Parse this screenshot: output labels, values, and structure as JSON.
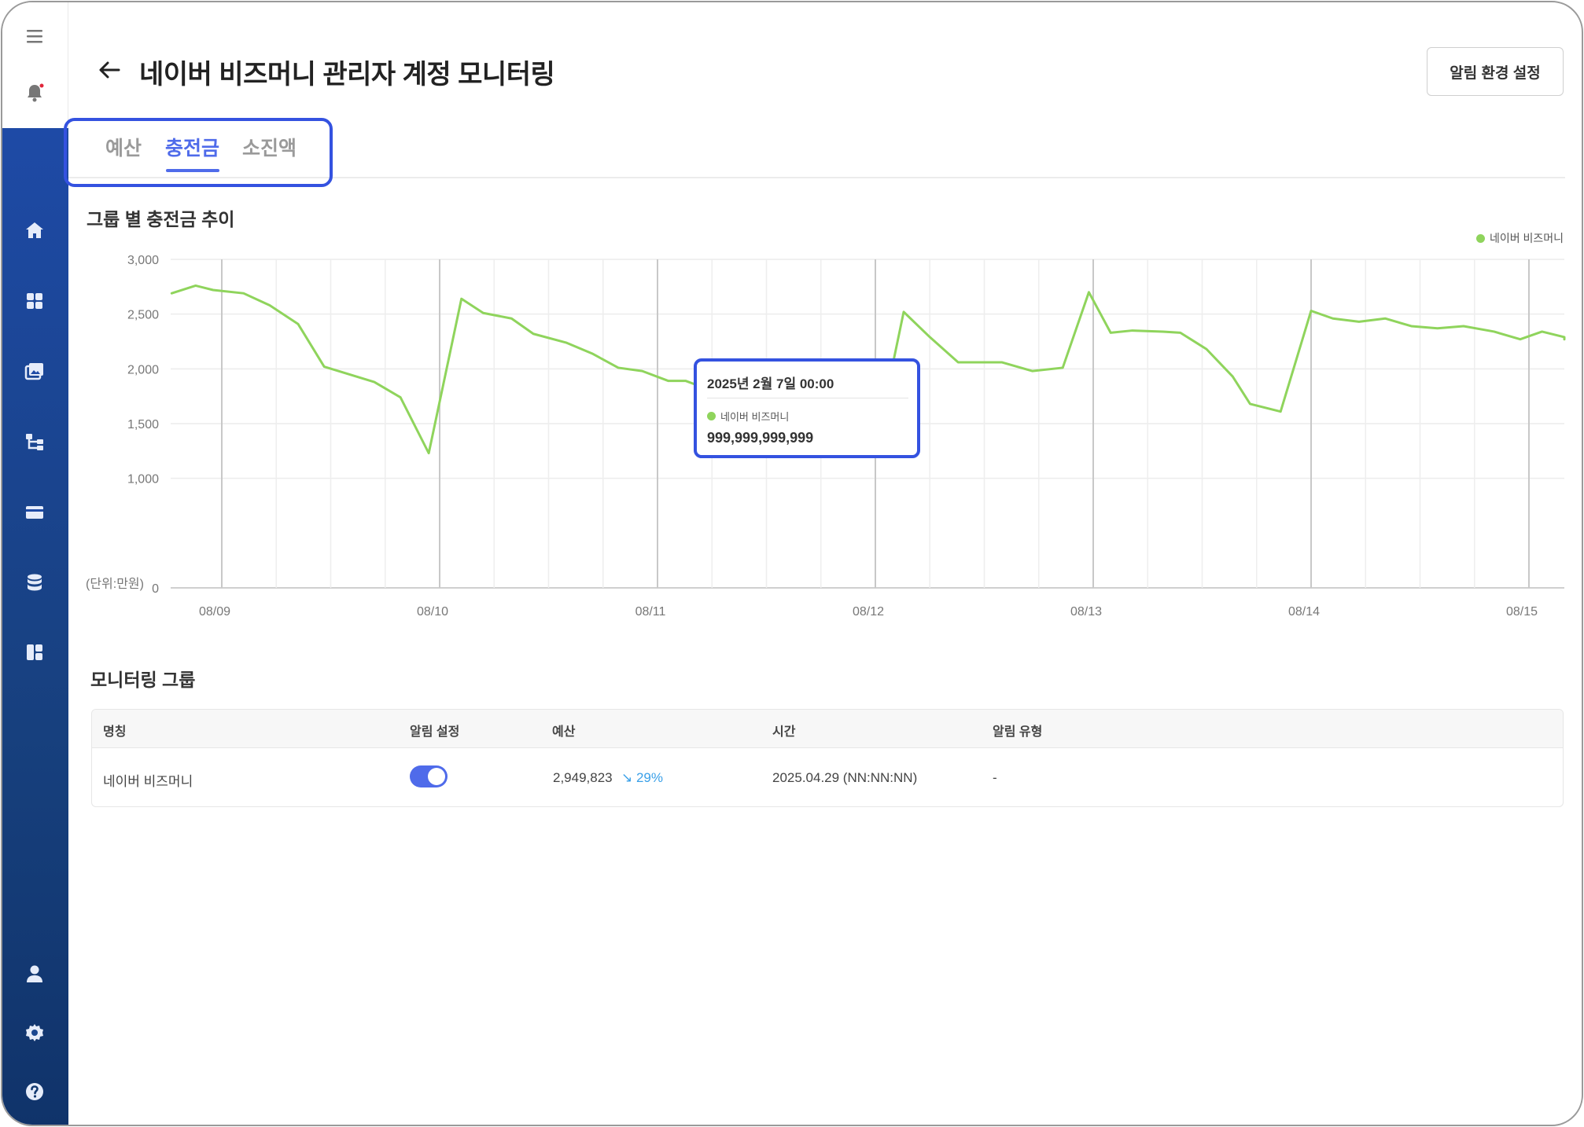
{
  "header": {
    "title": "네이버 비즈머니 관리자 계정 모니터링",
    "settings_label": "알림 환경 설정"
  },
  "sidebar": {
    "top_icons": [
      "menu-icon",
      "bell-icon"
    ],
    "items": [
      "home-icon",
      "dashboard-icon",
      "media-icon",
      "hierarchy-icon",
      "card-icon",
      "database-icon",
      "layout-icon"
    ],
    "bottom_items": [
      "user-icon",
      "gear-icon",
      "help-icon"
    ]
  },
  "tabs": [
    {
      "label": "예산",
      "active": false
    },
    {
      "label": "충전금",
      "active": true
    },
    {
      "label": "소진액",
      "active": false
    }
  ],
  "chart": {
    "title": "그룹 별 충전금 추이",
    "legend": "네이버 비즈머니",
    "y_unit": "(단위:만원)",
    "tooltip": {
      "date": "2025년 2월 7일 00:00",
      "series": "네이버 비즈머니",
      "value": "999,999,999,999"
    }
  },
  "chart_data": {
    "type": "line",
    "title": "그룹 별 충전금 추이",
    "ylabel": "(단위:만원)",
    "ylim": [
      0,
      3000
    ],
    "y_ticks": [
      0,
      1000,
      1500,
      2000,
      2500,
      3000
    ],
    "y_tick_labels": [
      "0",
      "1,000",
      "1,500",
      "2,000",
      "2,500",
      "3,000"
    ],
    "x_tick_labels": [
      "08/09",
      "08/10",
      "08/11",
      "08/12",
      "08/13",
      "08/14",
      "08/15"
    ],
    "grid": true,
    "legend_position": "top-right",
    "series": [
      {
        "name": "네이버 비즈머니",
        "color": "#8fd45c",
        "x": [
          -0.23,
          -0.12,
          -0.04,
          0.1,
          0.22,
          0.35,
          0.47,
          0.7,
          0.82,
          0.95,
          1.1,
          1.2,
          1.33,
          1.43,
          1.58,
          1.7,
          1.82,
          1.93,
          2.05,
          2.13,
          2.25,
          2.35,
          2.46,
          2.58,
          2.7,
          2.83,
          2.93,
          3.0,
          3.13,
          3.25,
          3.38,
          3.5,
          3.58,
          3.72,
          3.86,
          3.98,
          4.08,
          4.18,
          4.32,
          4.4,
          4.52,
          4.64,
          4.72,
          4.86,
          5.0,
          5.1,
          5.22,
          5.34,
          5.46,
          5.58,
          5.7,
          5.84,
          5.96,
          6.06,
          6.18,
          6.3
        ],
        "y": [
          2690,
          2760,
          2720,
          2690,
          2580,
          2410,
          2020,
          1880,
          1740,
          1230,
          2640,
          2510,
          2460,
          2320,
          2240,
          2140,
          2010,
          1980,
          1890,
          1890,
          1800,
          1720,
          1650,
          1560,
          1480,
          1400,
          1330,
          1280,
          2520,
          2290,
          2060,
          2060,
          2060,
          1980,
          2010,
          2700,
          2330,
          2350,
          2340,
          2330,
          2180,
          1930,
          1680,
          1610,
          2530,
          2460,
          2430,
          2460,
          2390,
          2370,
          2390,
          2340,
          2270,
          2340,
          2290,
          2270
        ]
      }
    ]
  },
  "monitoring": {
    "title": "모니터링 그룹",
    "columns": [
      "명칭",
      "알림 설정",
      "예산",
      "시간",
      "알림 유형"
    ],
    "rows": [
      {
        "name": "네이버 비즈머니",
        "alert_on": true,
        "budget": "2,949,823",
        "trend": "↘ 29%",
        "time": "2025.04.29 (NN:NN:NN)",
        "type": "-"
      }
    ]
  }
}
